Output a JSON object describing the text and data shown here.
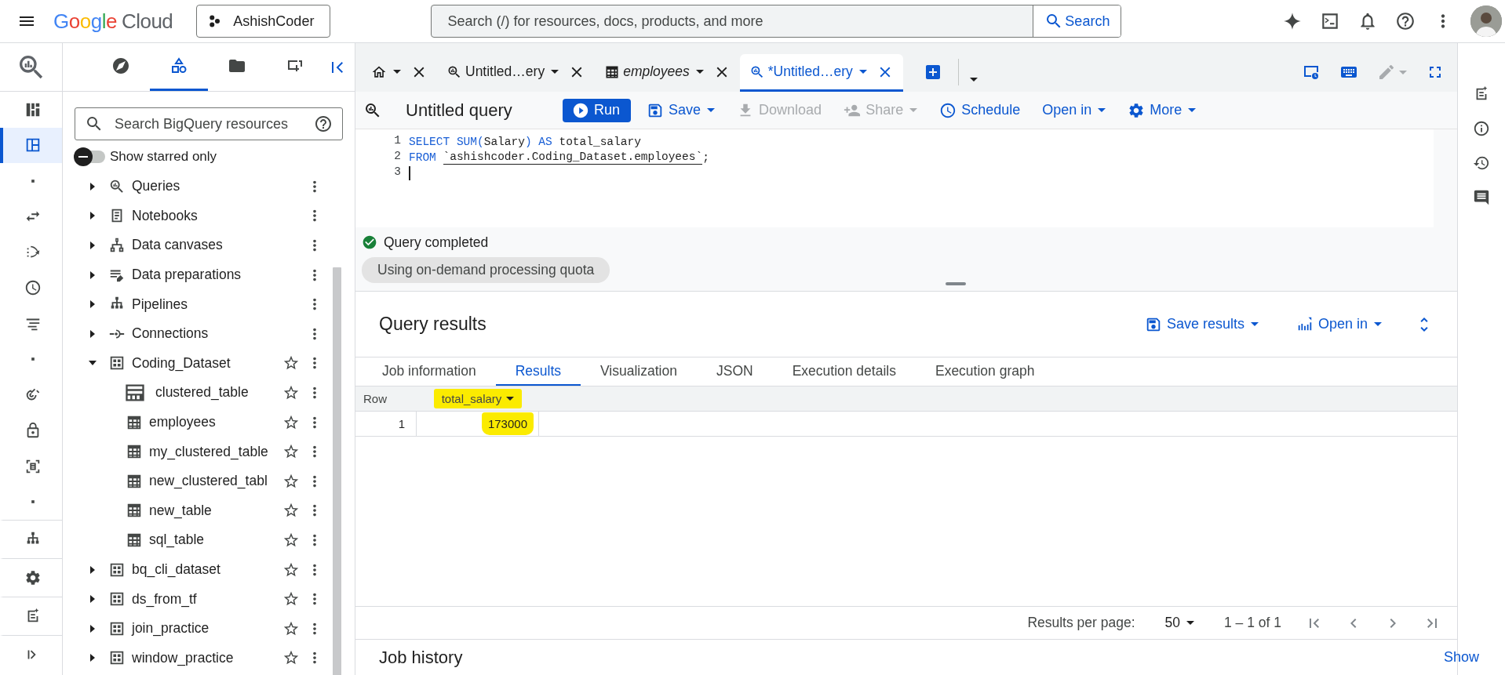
{
  "topbar": {
    "logo": {
      "brand": "Google",
      "product": "Cloud"
    },
    "project": "AshishCoder",
    "search": {
      "placeholder": "Search (/) for resources, docs, products, and more",
      "button": "Search"
    }
  },
  "left_rail": {
    "items": [
      {
        "selected": false
      },
      {
        "selected": true
      },
      {
        "selected": false
      },
      {
        "selected": false
      },
      {
        "selected": false
      },
      {
        "selected": false
      },
      {
        "selected": false
      },
      {
        "selected": false
      },
      {
        "selected": false
      },
      {
        "selected": false
      },
      {
        "selected": false
      },
      {
        "selected": false
      },
      {
        "selected": false
      },
      {
        "selected": false
      },
      {
        "selected": false
      },
      {
        "selected": false
      }
    ]
  },
  "explorer": {
    "tabs": [
      {
        "selected": false
      },
      {
        "selected": true
      },
      {
        "selected": false
      },
      {
        "selected": false
      }
    ],
    "search": {
      "placeholder": "Search BigQuery resources"
    },
    "starred_toggle": {
      "label": "Show starred only",
      "on": false
    },
    "tree": [
      {
        "label": "Queries",
        "kind": "query",
        "expanded": false
      },
      {
        "label": "Notebooks",
        "kind": "notebook",
        "expanded": false
      },
      {
        "label": "Data canvases",
        "kind": "canvas",
        "expanded": false
      },
      {
        "label": "Data preparations",
        "kind": "prep",
        "expanded": false
      },
      {
        "label": "Pipelines",
        "kind": "network",
        "expanded": false
      },
      {
        "label": "Connections",
        "kind": "connection",
        "expanded": false
      },
      {
        "label": "Coding_Dataset",
        "kind": "dataset",
        "expanded": true,
        "starred": false,
        "children": [
          {
            "label": "clustered_table",
            "kind": "clustered",
            "starred": false
          },
          {
            "label": "employees",
            "kind": "table",
            "starred": false
          },
          {
            "label": "my_clustered_table",
            "kind": "table",
            "starred": false
          },
          {
            "label": "new_clustered_tabl",
            "kind": "table",
            "starred": false
          },
          {
            "label": "new_table",
            "kind": "table",
            "starred": false
          },
          {
            "label": "sql_table",
            "kind": "table",
            "starred": false
          }
        ]
      },
      {
        "label": "bq_cli_dataset",
        "kind": "dataset",
        "expanded": false,
        "starred": false
      },
      {
        "label": "ds_from_tf",
        "kind": "dataset",
        "expanded": false,
        "starred": false
      },
      {
        "label": "join_practice",
        "kind": "dataset",
        "expanded": false,
        "starred": false
      },
      {
        "label": "window_practice",
        "kind": "dataset",
        "expanded": false,
        "starred": false
      }
    ]
  },
  "editor_tabs": [
    {
      "kind": "home",
      "selected": false
    },
    {
      "kind": "query",
      "label": "Untitled…ery",
      "selected": false
    },
    {
      "kind": "table",
      "label": "employees",
      "selected": false
    },
    {
      "kind": "query",
      "label": "*Untitled…ery",
      "selected": true
    }
  ],
  "toolbar": {
    "title": "Untitled query",
    "buttons": [
      {
        "label": "Run",
        "kind": "primary",
        "dropdown": false,
        "disabled": false
      },
      {
        "label": "Save",
        "kind": "text",
        "dropdown": true,
        "disabled": false
      },
      {
        "label": "Download",
        "kind": "text",
        "dropdown": false,
        "disabled": true
      },
      {
        "label": "Share",
        "kind": "text",
        "dropdown": true,
        "disabled": true
      },
      {
        "label": "Schedule",
        "kind": "text",
        "dropdown": false,
        "disabled": false
      },
      {
        "label": "Open in",
        "kind": "text",
        "dropdown": true,
        "disabled": false
      },
      {
        "label": "More",
        "kind": "text",
        "dropdown": true,
        "disabled": false
      }
    ]
  },
  "editor": {
    "lines": [
      {
        "number": "1",
        "cursor": false,
        "tokens": [
          {
            "kind": "keyword",
            "text": "SELECT SUM("
          },
          {
            "kind": "text",
            "text": "Salary"
          },
          {
            "kind": "keyword",
            "text": ") AS "
          },
          {
            "kind": "text",
            "text": "total_salary"
          }
        ]
      },
      {
        "number": "2",
        "cursor": false,
        "tokens": [
          {
            "kind": "keyword",
            "text": "FROM "
          },
          {
            "kind": "table_ref",
            "text": "`ashishcoder.Coding_Dataset.employees`"
          },
          {
            "kind": "text",
            "text": ";"
          }
        ]
      },
      {
        "number": "3",
        "cursor": true
      }
    ]
  },
  "status": {
    "message": "Query completed",
    "chip": "Using on-demand processing quota"
  },
  "results": {
    "title": "Query results",
    "actions": [
      {
        "label": "Save results"
      },
      {
        "label": "Open in"
      }
    ],
    "tabs": [
      {
        "label": "Job information",
        "selected": false
      },
      {
        "label": "Results",
        "selected": true
      },
      {
        "label": "Visualization",
        "selected": false
      },
      {
        "label": "JSON",
        "selected": false
      },
      {
        "label": "Execution details",
        "selected": false
      },
      {
        "label": "Execution graph",
        "selected": false
      }
    ],
    "table": {
      "columns": [
        "Row",
        "total_salary"
      ],
      "rows": [
        {
          "row": "1",
          "cells": [
            "173000"
          ]
        }
      ]
    },
    "pagination": {
      "per_page_label": "Results per page:",
      "per_page": "50",
      "range": "1 – 1 of 1"
    }
  },
  "job_history": {
    "title": "Job history",
    "action": "Show"
  }
}
